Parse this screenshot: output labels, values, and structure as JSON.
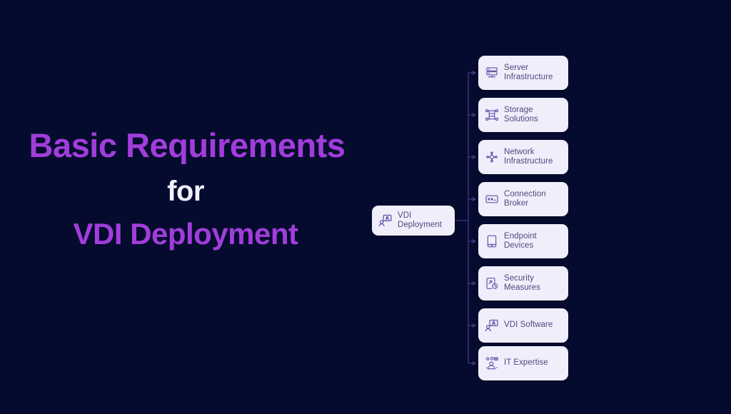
{
  "theme": {
    "background": "#050b2e",
    "accent_purple": "#a13ddb",
    "title_white": "#f1effb",
    "node_fill": "#f0eefb",
    "node_text": "#4c4b7d",
    "connector": "#4b3f8c",
    "icon": "#5a55a8"
  },
  "title": {
    "line1": "Basic Requirements",
    "line2": "for",
    "line3": "VDI Deployment"
  },
  "diagram": {
    "root": {
      "label": "VDI Deployment",
      "icon": "monitor-user-icon"
    },
    "branches": [
      {
        "label": "Server Infrastructure",
        "icon": "server-stack-icon"
      },
      {
        "label": "Storage Solutions",
        "icon": "storage-network-icon"
      },
      {
        "label": "Network Infrastructure",
        "icon": "network-share-icon"
      },
      {
        "label": "Connection Broker",
        "icon": "connection-card-icon"
      },
      {
        "label": "Endpoint Devices",
        "icon": "tablet-device-icon"
      },
      {
        "label": "Security Measures",
        "icon": "document-clock-icon"
      },
      {
        "label": "VDI Software",
        "icon": "monitor-user-icon"
      },
      {
        "label": "IT Expertise",
        "icon": "people-group-icon"
      }
    ]
  }
}
